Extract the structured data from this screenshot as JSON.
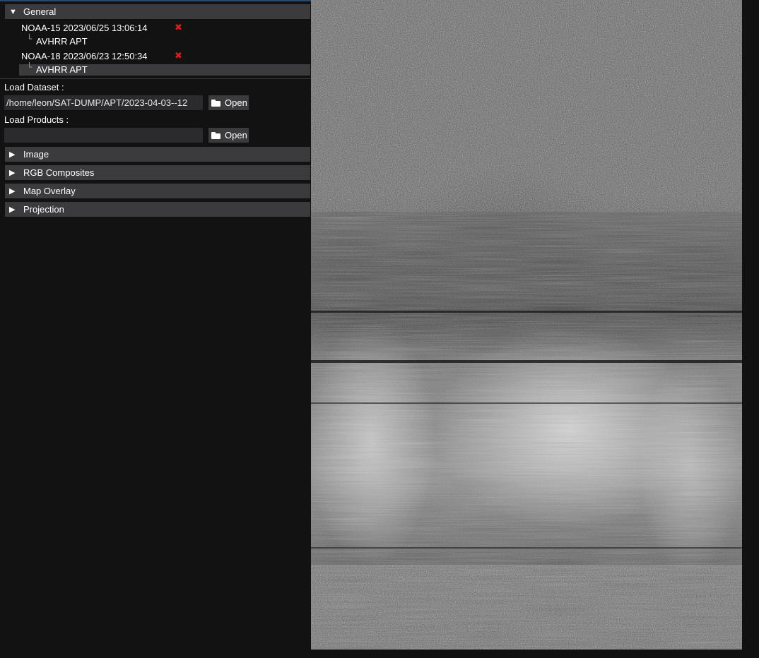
{
  "tree": {
    "general_header": "General",
    "datasets": [
      {
        "name": "NOAA-15 2023/06/25 13:06:14",
        "product": "AVHRR APT",
        "close_icon": "close-x"
      },
      {
        "name": "NOAA-18 2023/06/23 12:50:34",
        "product": "AVHRR APT",
        "close_icon": "close-x"
      }
    ],
    "tree_glyph": "└"
  },
  "load_dataset": {
    "label": "Load Dataset :",
    "path": "/home/leon/SAT-DUMP/APT/2023-04-03--12",
    "open_label": "Open"
  },
  "load_products": {
    "label": "Load Products :",
    "path": "",
    "open_label": "Open"
  },
  "sections": [
    {
      "label": "Image"
    },
    {
      "label": "RGB Composites"
    },
    {
      "label": "Map Overlay"
    },
    {
      "label": "Projection"
    }
  ],
  "icons": {
    "expanded": "▼",
    "collapsed": "▶",
    "close": "✖"
  },
  "colors": {
    "panel_bg": "#121212",
    "header_bg": "#3b3b3e",
    "close_red": "#e01b1b",
    "field_bg": "#2b2b2e"
  }
}
